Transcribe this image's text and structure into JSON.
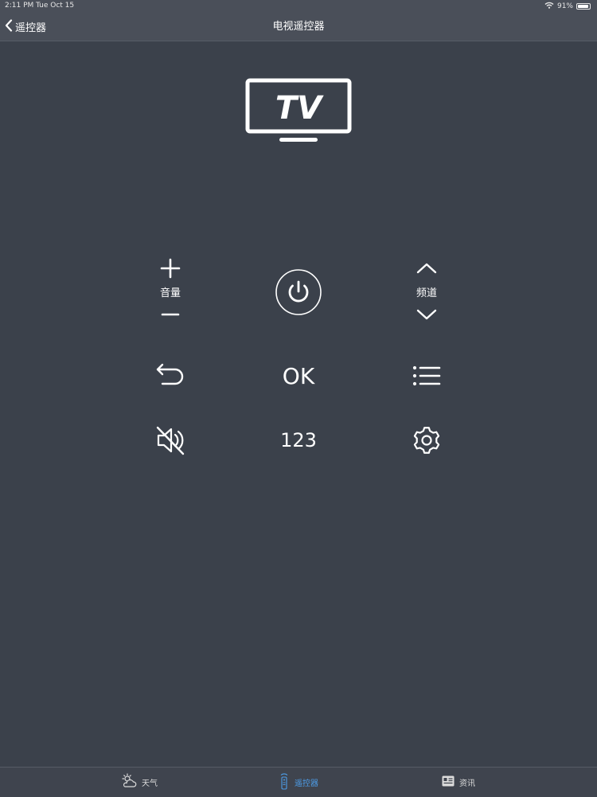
{
  "status_bar": {
    "time": "2:11 PM",
    "date": "Tue Oct 15",
    "battery": "91%",
    "battery_level": 0.91,
    "icons": [
      "wifi-icon",
      "battery-icon"
    ]
  },
  "nav": {
    "back_label": "遥控器",
    "title": "电视遥控器"
  },
  "logo": {
    "text": "TV"
  },
  "remote": {
    "volume_label": "音量",
    "channel_label": "频道",
    "ok_label": "OK",
    "number_label": "123",
    "icons": [
      "plus-icon",
      "minus-icon",
      "power-icon",
      "chevron-up-icon",
      "chevron-down-icon",
      "back-arrow-icon",
      "menu-list-icon",
      "mute-icon",
      "gear-icon"
    ]
  },
  "tabs": [
    {
      "label": "天气",
      "icon": "weather-icon",
      "active": false
    },
    {
      "label": "遥控器",
      "icon": "remote-icon",
      "active": true
    },
    {
      "label": "资讯",
      "icon": "news-icon",
      "active": false
    }
  ],
  "colors": {
    "background": "#3b414b",
    "bar": "#4a4f59",
    "accent": "#4d9de8"
  }
}
